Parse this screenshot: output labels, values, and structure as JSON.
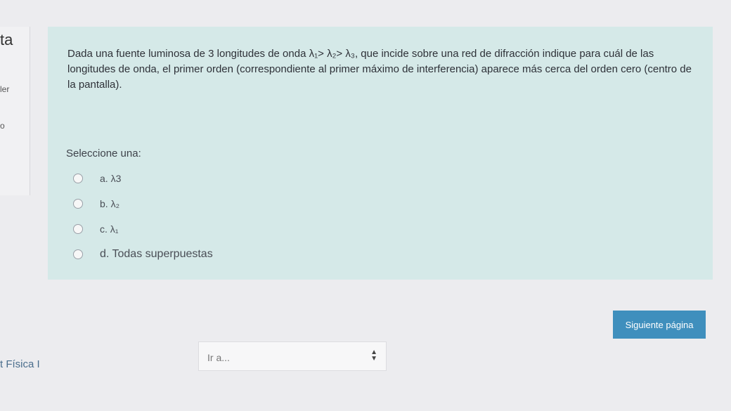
{
  "left": {
    "title_fragment": "ta",
    "flag_fragment": "ler",
    "points_fragment": "o"
  },
  "question": {
    "text": "Dada una fuente luminosa de 3 longitudes de onda λ₁> λ₂> λ₃, que incide sobre una red de difracción indique para cuál de las longitudes de onda, el primer orden (correspondiente al primer máximo de interferencia) aparece más cerca del orden cero (centro de la pantalla).",
    "prompt": "Seleccione una:",
    "options": [
      {
        "label": "a. λ3"
      },
      {
        "label": "b. λ₂"
      },
      {
        "label": "c. λ₁"
      },
      {
        "label": "d. Todas superpuestas"
      }
    ]
  },
  "navigation": {
    "next_label": "Siguiente página",
    "course_link": "t Física I",
    "jump_placeholder": "Ir a..."
  },
  "colors": {
    "question_bg": "#d5e9e8",
    "button_bg": "#3f8fbd",
    "page_bg": "#ececef"
  }
}
